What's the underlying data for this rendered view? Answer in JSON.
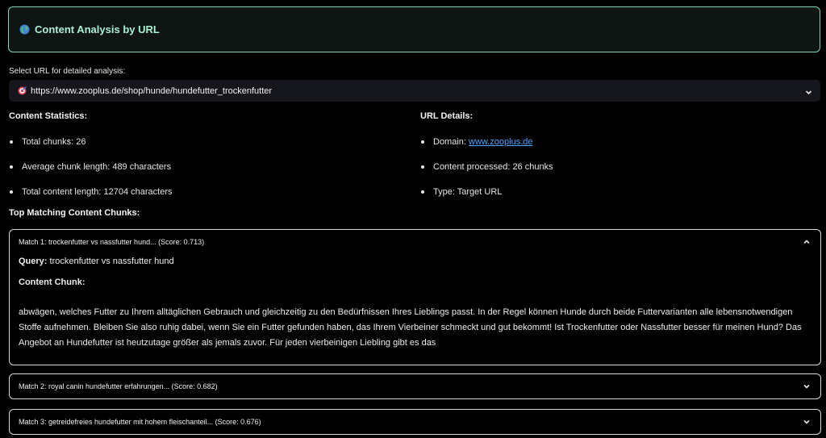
{
  "header": {
    "title": "Content Analysis by URL",
    "icon": "globe-icon",
    "accent_color": "#a8f0d4",
    "border_color": "#7fd3b0"
  },
  "url_select": {
    "label": "Select URL for detailed analysis:",
    "icon": "target-icon",
    "selected": "https://www.zooplus.de/shop/hunde/hundefutter_trockenfutter"
  },
  "content_statistics": {
    "heading": "Content Statistics:",
    "items": [
      "Total chunks: 26",
      "Average chunk length: 489 characters",
      "Total content length: 12704 characters"
    ]
  },
  "url_details": {
    "heading": "URL Details:",
    "domain_label": "Domain: ",
    "domain_link": "www.zooplus.de",
    "items": [
      "Content processed: 26 chunks",
      "Type: Target URL"
    ],
    "link_color": "#4ea3ff"
  },
  "top_matching": {
    "heading": "Top Matching Content Chunks:",
    "matches": [
      {
        "title": "Match 1: trockenfutter vs nassfutter hund... (Score: 0.713)",
        "expanded": true,
        "query_label": "Query:",
        "query_value": "trockenfutter vs nassfutter hund",
        "chunk_label": "Content Chunk:",
        "chunk_text": "abwägen, welches Futter zu Ihrem alltäglichen Gebrauch und gleichzeitig zu den Bedürfnissen Ihres Lieblings passt. In der Regel können Hunde durch beide Futtervarianten alle lebensnotwendigen Stoffe aufnehmen. Bleiben Sie also ruhig dabei, wenn Sie ein Futter gefunden haben, das Ihrem Vierbeiner schmeckt und gut bekommt! Ist Trockenfutter oder Nassfutter besser für meinen Hund? Das Angebot an Hundefutter ist heutzutage größer als jemals zuvor. Für jeden vierbeinigen Liebling gibt es das"
      },
      {
        "title": "Match 2: royal canin hundefutter erfahrungen... (Score: 0.682)",
        "expanded": false
      },
      {
        "title": "Match 3: getreidefreies hundefutter mit hohem fleischanteil... (Score: 0.676)",
        "expanded": false
      }
    ]
  }
}
